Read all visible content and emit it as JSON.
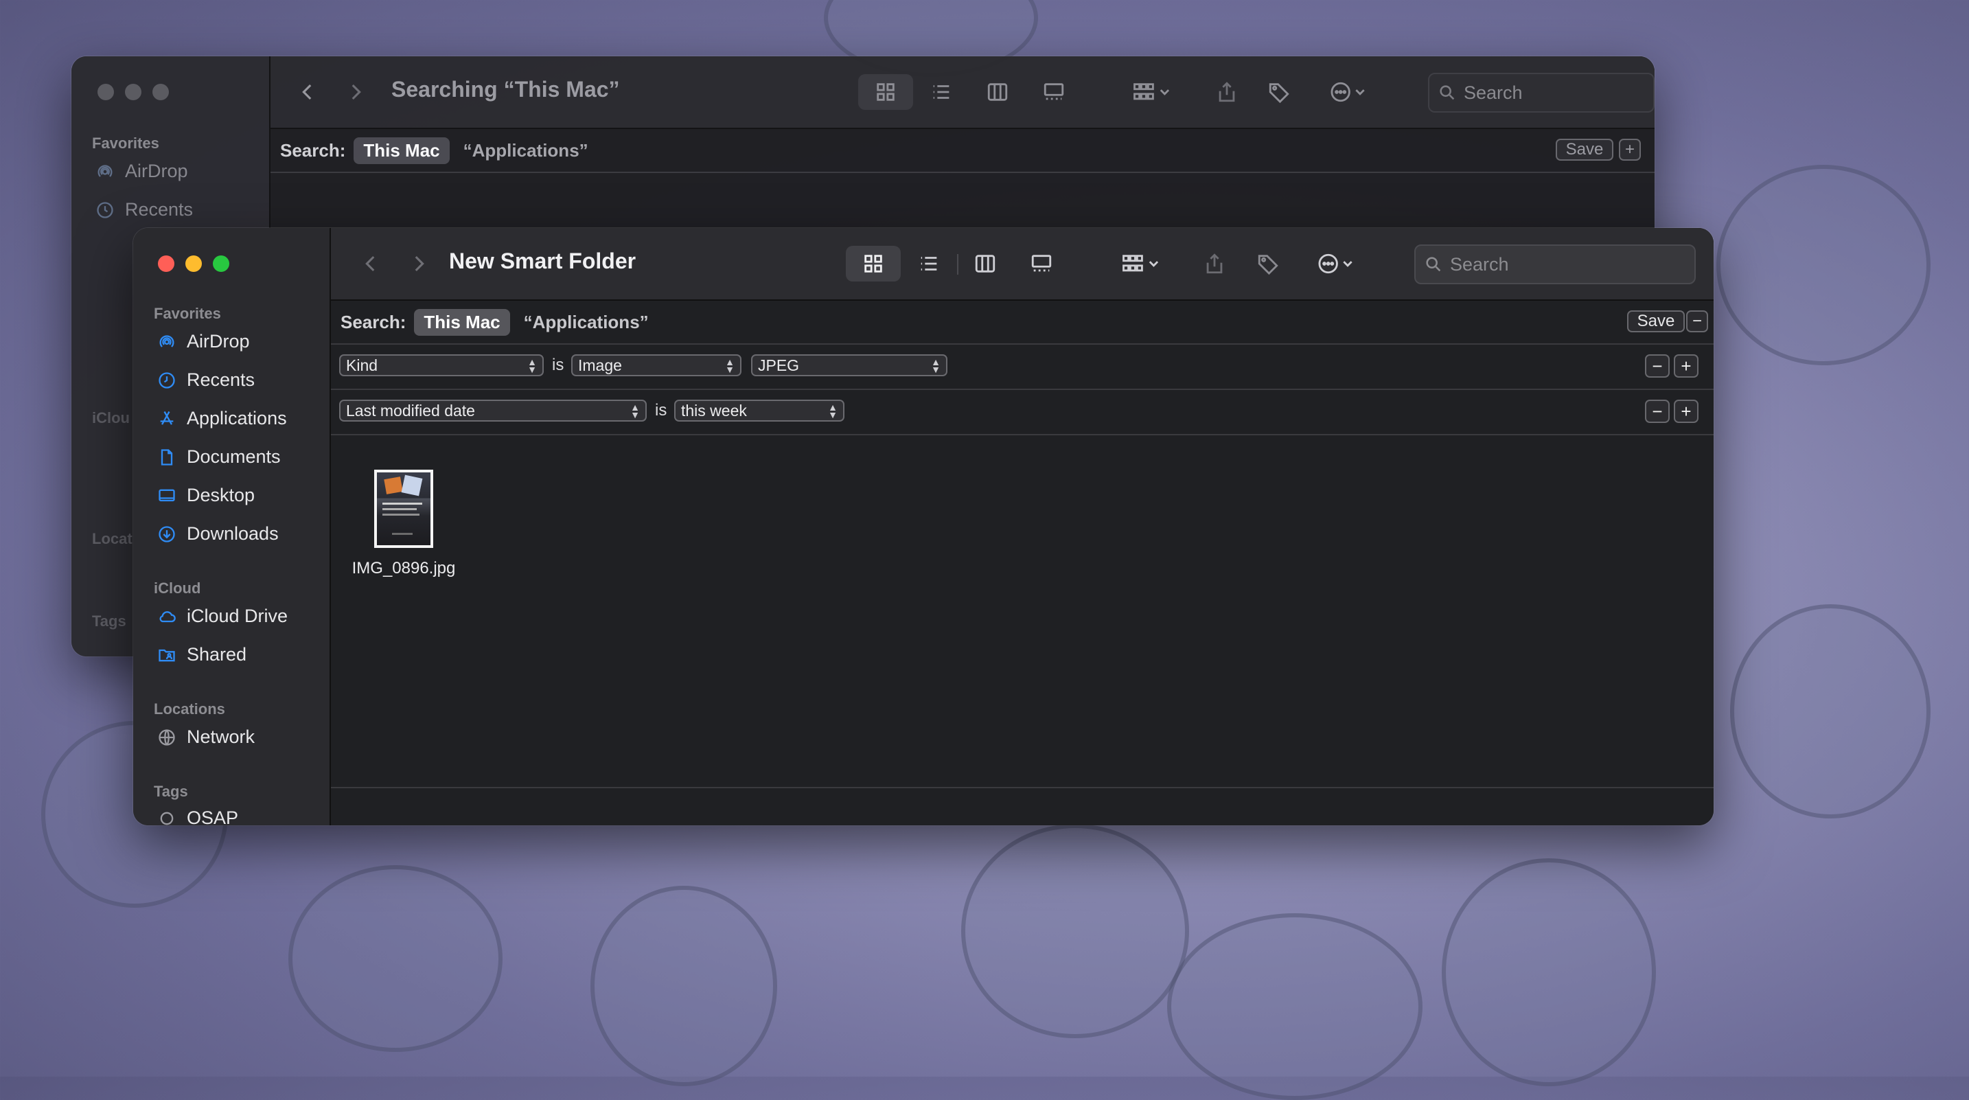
{
  "background_window": {
    "title": "Searching “This Mac”",
    "sidebar": {
      "favorites_header": "Favorites",
      "items": [
        "AirDrop",
        "Recents"
      ],
      "partial_headers": [
        "iClou",
        "Locat",
        "Tags"
      ]
    },
    "search_placeholder": "Search",
    "scope": {
      "label": "Search:",
      "selected": "This Mac",
      "alternate": "“Applications”",
      "save": "Save",
      "add": "+"
    }
  },
  "front_window": {
    "title": "New Smart Folder",
    "sidebar": {
      "favorites_header": "Favorites",
      "favorites": [
        {
          "label": "AirDrop",
          "icon": "airdrop-icon"
        },
        {
          "label": "Recents",
          "icon": "clock-icon"
        },
        {
          "label": "Applications",
          "icon": "applications-icon"
        },
        {
          "label": "Documents",
          "icon": "document-icon"
        },
        {
          "label": "Desktop",
          "icon": "desktop-icon"
        },
        {
          "label": "Downloads",
          "icon": "download-icon"
        }
      ],
      "icloud_header": "iCloud",
      "icloud": [
        {
          "label": "iCloud Drive",
          "icon": "cloud-icon"
        },
        {
          "label": "Shared",
          "icon": "shared-folder-icon"
        }
      ],
      "locations_header": "Locations",
      "locations": [
        {
          "label": "Network",
          "icon": "globe-icon"
        }
      ],
      "tags_header": "Tags",
      "tags": [
        {
          "label": "OSAP",
          "icon": "tag-circle-icon"
        }
      ]
    },
    "search_placeholder": "Search",
    "scope": {
      "label": "Search:",
      "selected": "This Mac",
      "alternate": "“Applications”",
      "save": "Save",
      "remove": "−"
    },
    "rules": [
      {
        "attribute": "Kind",
        "operator": "is",
        "value": "Image",
        "subvalue": "JPEG"
      },
      {
        "attribute": "Last modified date",
        "operator": "is",
        "value": "this week"
      }
    ],
    "files": [
      {
        "name": "IMG_0896.jpg"
      }
    ],
    "colors": {
      "close": "#ff5f57",
      "minimize": "#febc2e",
      "zoom": "#28c840",
      "accent": "#2f8cf5"
    }
  }
}
